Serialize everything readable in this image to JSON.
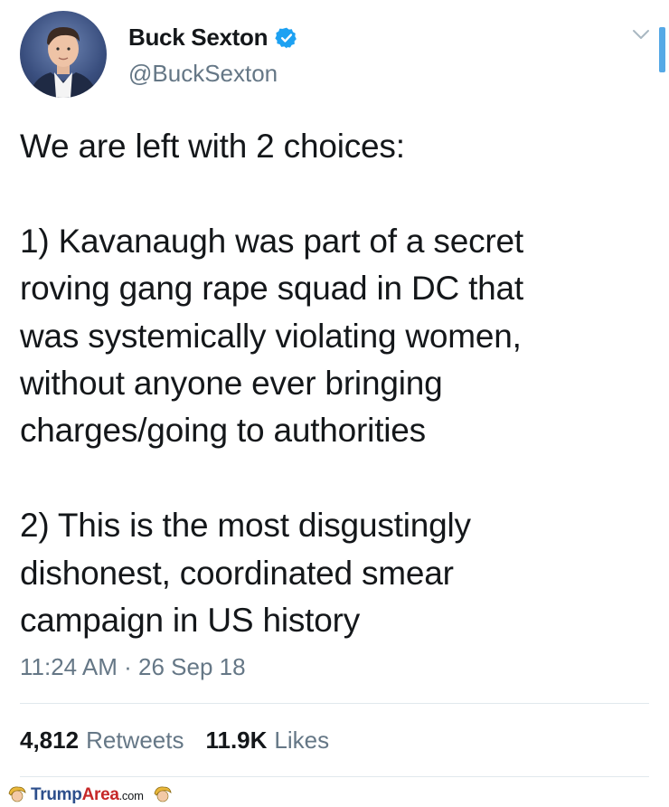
{
  "author": {
    "name": "Buck Sexton",
    "handle": "@BuckSexton",
    "verified": true
  },
  "tweet": {
    "text": "We are left with 2 choices:\n\n1) Kavanaugh was part of a secret\nroving gang rape squad in DC that\nwas systemically violating women,\nwithout anyone ever bringing\ncharges/going to authorities\n\n2) This is the most disgustingly\ndishonest, coordinated smear\ncampaign in US history",
    "timestamp": "11:24 AM · 26 Sep 18"
  },
  "stats": {
    "retweets_count": "4,812",
    "retweets_label": "Retweets",
    "likes_count": "11.9K",
    "likes_label": "Likes"
  },
  "watermark": {
    "part1": "Trump",
    "part2": "Area",
    "part3": ".com"
  },
  "colors": {
    "accent": "#1da1f2",
    "secondary_text": "#657786",
    "primary_text": "#14171a"
  },
  "icons": {
    "verified": "verified-badge-icon",
    "caret": "chevron-down-icon",
    "watermark_logo": "trump-hair-logo-icon"
  }
}
